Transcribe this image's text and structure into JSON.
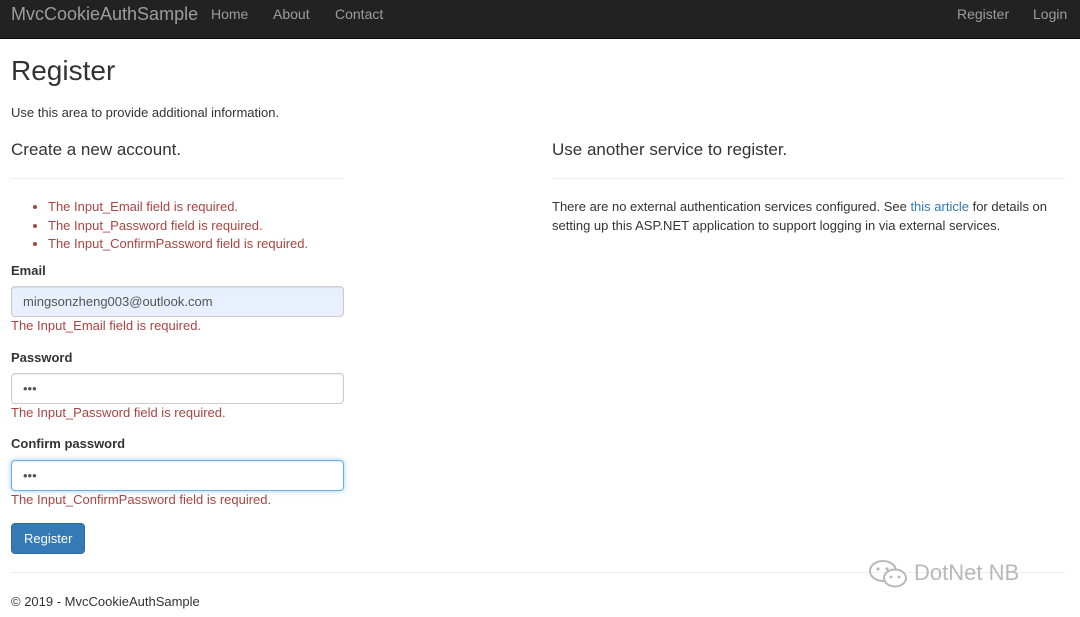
{
  "navbar": {
    "brand": "MvcCookieAuthSample",
    "left_links": [
      "Home",
      "About",
      "Contact"
    ],
    "right_links": [
      "Register",
      "Login"
    ]
  },
  "page": {
    "title": "Register",
    "intro": "Use this area to provide additional information."
  },
  "form": {
    "section_title": "Create a new account.",
    "summary_errors": [
      "The Input_Email field is required.",
      "The Input_Password field is required.",
      "The Input_ConfirmPassword field is required."
    ],
    "email": {
      "label": "Email",
      "value": "mingsonzheng003@outlook.com",
      "error": "The Input_Email field is required."
    },
    "password": {
      "label": "Password",
      "value": "•••",
      "error": "The Input_Password field is required."
    },
    "confirm_password": {
      "label": "Confirm password",
      "value": "•••",
      "error": "The Input_ConfirmPassword field is required."
    },
    "submit_label": "Register"
  },
  "external": {
    "section_title": "Use another service to register.",
    "text_before": "There are no external authentication services configured. See ",
    "link_text": "this article",
    "text_after": " for details on setting up this ASP.NET application to support logging in via external services."
  },
  "footer": {
    "text": "© 2019 - MvcCookieAuthSample"
  },
  "watermark": {
    "text": "DotNet NB",
    "icon": "wechat-icon"
  },
  "colors": {
    "navbar_bg": "#222222",
    "error": "#a94442",
    "primary": "#337ab7",
    "link": "#337ab7"
  }
}
